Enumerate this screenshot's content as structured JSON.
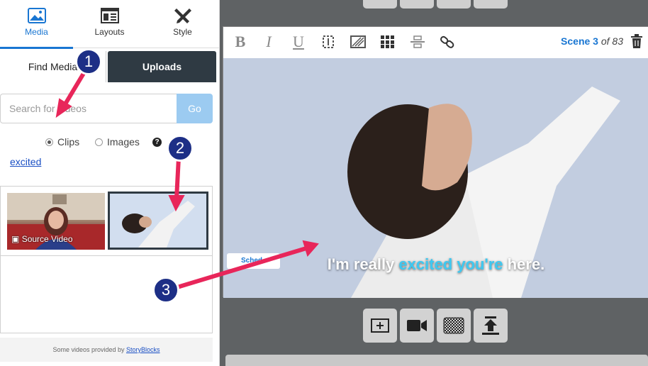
{
  "nav": {
    "media": "Media",
    "layouts": "Layouts",
    "style": "Style"
  },
  "tabs": {
    "find_media": "Find Media",
    "uploads": "Uploads"
  },
  "search": {
    "placeholder": "Search for videos",
    "go": "Go"
  },
  "filter": {
    "clips": "Clips",
    "images": "Images",
    "help": "?",
    "selected": "Clips"
  },
  "tag": "excited",
  "results": {
    "source_label": "Source Video"
  },
  "credit": {
    "prefix": "Some videos provided by ",
    "link": "StoryBlocks"
  },
  "editor": {
    "scene_word": "Scene",
    "scene_num": "3",
    "scene_of": "of 83",
    "caption_pre": "I'm really ",
    "caption_hl": "excited you're",
    "caption_post": " here.",
    "badge": "Sched"
  },
  "annotations": {
    "m1": "1",
    "m2": "2",
    "m3": "3"
  },
  "colors": {
    "accent": "#1976d2",
    "uploads_tab": "#2f3a43",
    "go_button": "#9ccbf1",
    "marker": "#1d2f86",
    "arrow": "#e8265a",
    "caption_highlight": "#3fc8f0"
  }
}
